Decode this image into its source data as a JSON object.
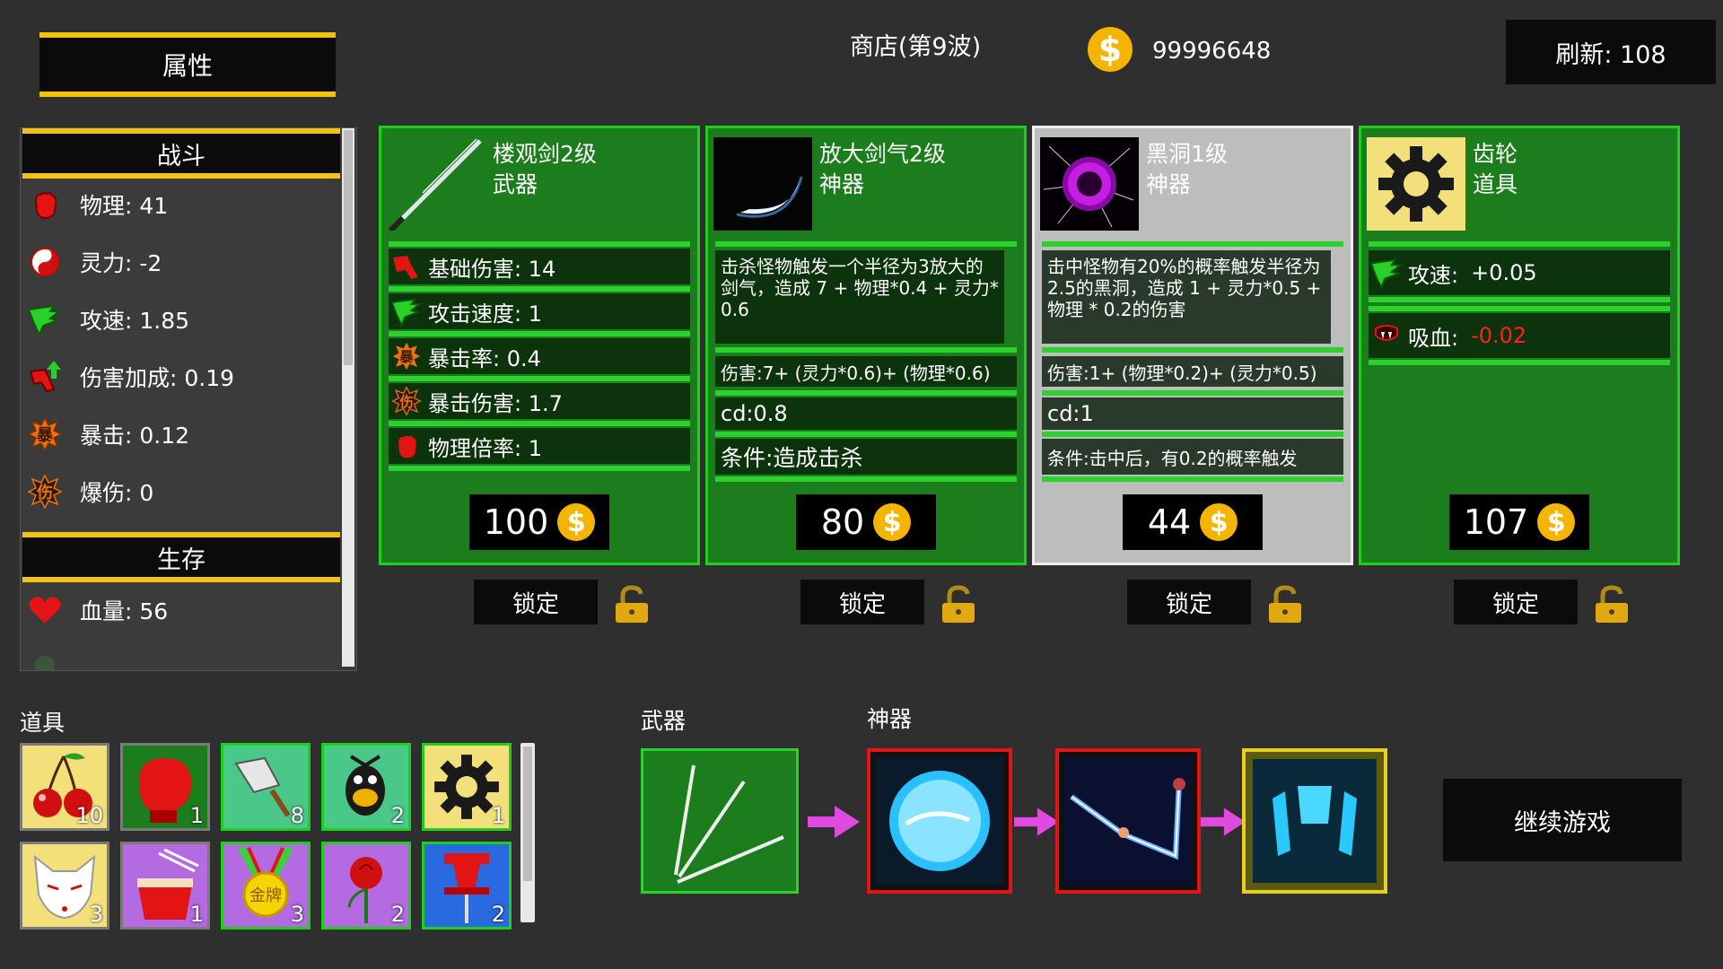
{
  "attr_header": "属性",
  "stats": {
    "combat_header": "战斗",
    "combat": [
      {
        "icon": "fist-icon",
        "label": "物理: 41"
      },
      {
        "icon": "yin-yang-icon",
        "label": "灵力: -2"
      },
      {
        "icon": "speed-wing-icon",
        "label": "攻速: 1.85"
      },
      {
        "icon": "damage-up-icon",
        "label": "伤害加成: 0.19"
      },
      {
        "icon": "crit-icon",
        "label": "暴击: 0.12"
      },
      {
        "icon": "crit-damage-icon",
        "label": "爆伤: 0"
      }
    ],
    "survive_header": "生存",
    "survive": [
      {
        "icon": "heart-icon",
        "label": "血量: 56"
      }
    ]
  },
  "shop": {
    "title": "商店(第9波)",
    "coins": "99996648",
    "refresh_label": "刷新: 108",
    "lock_label": "锁定",
    "cards": [
      {
        "name": "楼观剑2级",
        "type": "武器",
        "attributes": [
          {
            "icon": "damage-icon",
            "label": "基础伤害: 14"
          },
          {
            "icon": "speed-wing-icon",
            "label": "攻击速度: 1"
          },
          {
            "icon": "crit-icon",
            "label": "暴击率: 0.4"
          },
          {
            "icon": "crit-damage-icon",
            "label": "暴击伤害: 1.7"
          },
          {
            "icon": "fist-icon",
            "label": "物理倍率: 1"
          }
        ],
        "price": "100"
      },
      {
        "name": "放大剑气2级",
        "type": "神器",
        "description": "击杀怪物触发一个半径为3放大的剑气，造成 7 + 物理*0.4 + 灵力* 0.6",
        "formula": "伤害:7+ (灵力*0.6)+ (物理*0.6)",
        "cd": "cd:0.8",
        "condition": "条件:造成击杀",
        "price": "80"
      },
      {
        "name": "黑洞1级",
        "type": "神器",
        "description": "击中怪物有20%的概率触发半径为2.5的黑洞，造成 1 + 灵力*0.5 + 物理 * 0.2的伤害",
        "formula": "伤害:1+ (物理*0.2)+ (灵力*0.5)",
        "cd": "cd:1",
        "condition": "条件:击中后，有0.2的概率触发",
        "price": "44"
      },
      {
        "name": "齿轮",
        "type": "道具",
        "attributes": [
          {
            "icon": "speed-wing-icon",
            "label": "攻速:",
            "value": "+0.05"
          },
          {
            "icon": "vampire-icon",
            "label": "吸血:",
            "value": "-0.02"
          }
        ],
        "price": "107"
      }
    ]
  },
  "props": {
    "title": "道具",
    "items": [
      {
        "icon": "cherry-icon",
        "count": "10"
      },
      {
        "icon": "boxing-glove-icon",
        "count": "1"
      },
      {
        "icon": "cleaver-icon",
        "count": "8"
      },
      {
        "icon": "duck-warrior-icon",
        "count": "2"
      },
      {
        "icon": "gear-icon",
        "count": "1"
      },
      {
        "icon": "fox-mask-icon",
        "count": "3"
      },
      {
        "icon": "noodle-bowl-icon",
        "count": "1"
      },
      {
        "icon": "gold-medal-icon",
        "count": "3",
        "text": "金牌"
      },
      {
        "icon": "rose-icon",
        "count": "2"
      },
      {
        "icon": "pushpin-icon",
        "count": "2"
      }
    ]
  },
  "equipment": {
    "weapon_label": "武器",
    "artifact_label": "神器"
  },
  "continue_label": "继续游戏",
  "colors": {
    "card_green": "#1b7d1b",
    "border_green": "#1ecf1e",
    "gold": "#f2c40f",
    "coin": "#f5b400",
    "negative": "#ff2020"
  }
}
